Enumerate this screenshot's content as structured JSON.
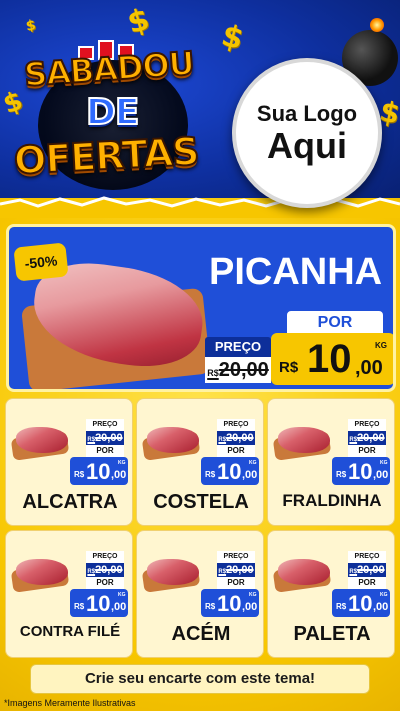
{
  "header": {
    "title_line1": "SABADOU",
    "title_line2": "DE",
    "title_line3": "OFERTAS",
    "logo_line1": "Sua Logo",
    "logo_line2": "Aqui",
    "dollar_symbol": "$"
  },
  "hero": {
    "discount": "-50%",
    "name": "PICANHA",
    "preco_label": "PREÇO",
    "old_currency": "R$",
    "old_price": "20,00",
    "por_label": "POR",
    "currency": "R$",
    "price_int": "10",
    "price_dec": ",00",
    "unit": "KG"
  },
  "products": [
    {
      "name": "ALCATRA",
      "preco_label": "PREÇO",
      "old_currency": "R$",
      "old_price": "20,00",
      "por_label": "POR",
      "currency": "R$",
      "price_int": "10",
      "price_dec": ",00",
      "unit": "KG"
    },
    {
      "name": "COSTELA",
      "preco_label": "PREÇO",
      "old_currency": "R$",
      "old_price": "20,00",
      "por_label": "POR",
      "currency": "R$",
      "price_int": "10",
      "price_dec": ",00",
      "unit": "KG"
    },
    {
      "name": "FRALDINHA",
      "preco_label": "PREÇO",
      "old_currency": "R$",
      "old_price": "20,00",
      "por_label": "POR",
      "currency": "R$",
      "price_int": "10",
      "price_dec": ",00",
      "unit": "KG"
    },
    {
      "name": "CONTRA FILÉ",
      "preco_label": "PREÇO",
      "old_currency": "R$",
      "old_price": "20,00",
      "por_label": "POR",
      "currency": "R$",
      "price_int": "10",
      "price_dec": ",00",
      "unit": "KG"
    },
    {
      "name": "ACÉM",
      "preco_label": "PREÇO",
      "old_currency": "R$",
      "old_price": "20,00",
      "por_label": "POR",
      "currency": "R$",
      "price_int": "10",
      "price_dec": ",00",
      "unit": "KG"
    },
    {
      "name": "PALETA",
      "preco_label": "PREÇO",
      "old_currency": "R$",
      "old_price": "20,00",
      "por_label": "POR",
      "currency": "R$",
      "price_int": "10",
      "price_dec": ",00",
      "unit": "KG"
    }
  ],
  "footer": {
    "cta": "Crie seu encarte com este tema!",
    "disclaimer": "*Imagens Meramente Ilustrativas"
  },
  "colors": {
    "header_blue": "#0e2f9e",
    "card_blue": "#1f4fd8",
    "yellow": "#f7c600"
  }
}
